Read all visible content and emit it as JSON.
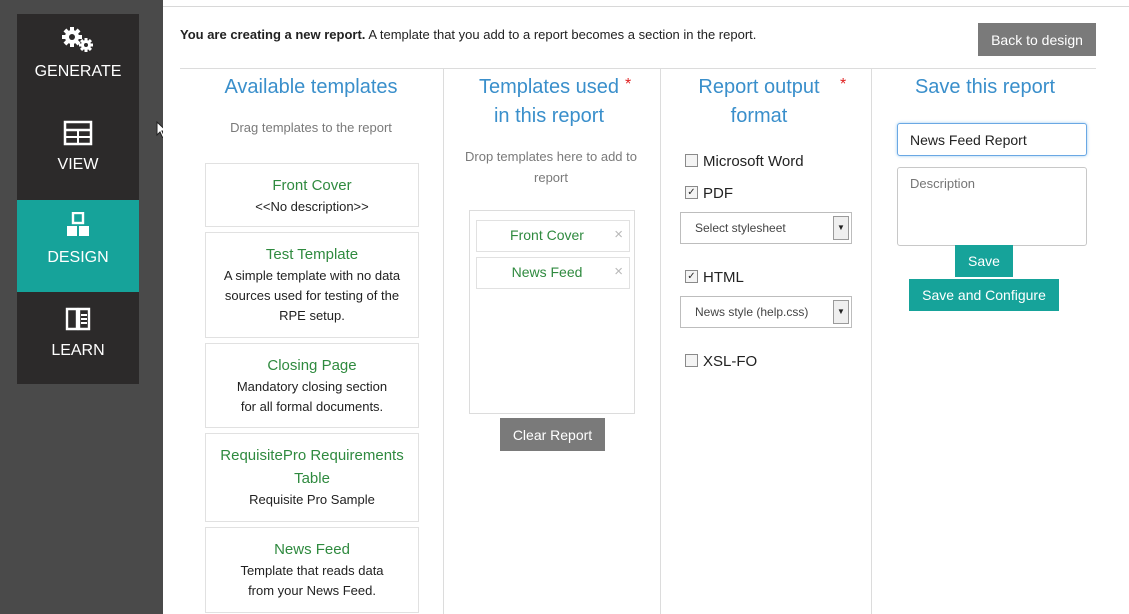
{
  "nav": {
    "items": [
      {
        "label": "GENERATE",
        "icon": "gears-icon"
      },
      {
        "label": "VIEW",
        "icon": "table-icon"
      },
      {
        "label": "DESIGN",
        "icon": "blocks-icon",
        "active": true
      },
      {
        "label": "LEARN",
        "icon": "book-icon"
      }
    ]
  },
  "header": {
    "intro_bold": "You are creating a new report.",
    "intro_rest": " A template that you add to a report becomes a section in the report.",
    "back_label": "Back to design"
  },
  "available": {
    "title": "Available templates",
    "hint": "Drag templates to the report",
    "templates": [
      {
        "name": "Front Cover",
        "desc": "<<No description>>"
      },
      {
        "name": "Test Template",
        "desc": "A simple template with no data sources used for testing of the RPE setup."
      },
      {
        "name": "Closing Page",
        "desc": "Mandatory closing section for all formal documents."
      },
      {
        "name": "RequisitePro Requirements Table",
        "desc": "Requisite Pro Sample"
      },
      {
        "name": "News Feed",
        "desc": "Template that reads data from your News Feed."
      }
    ]
  },
  "used": {
    "title_line1": "Templates used",
    "title_line2": "in this report",
    "required_mark": "*",
    "hint": "Drop templates here to add to report",
    "items": [
      {
        "label": "Front Cover",
        "remove": "×"
      },
      {
        "label": "News Feed",
        "remove": "×"
      }
    ],
    "clear_label": "Clear Report"
  },
  "output": {
    "title_line1": "Report output",
    "title_line2": "format",
    "required_mark": "*",
    "formats": [
      {
        "label": "Microsoft Word",
        "checked": false
      },
      {
        "label": "PDF",
        "checked": true
      },
      {
        "label": "HTML",
        "checked": true
      },
      {
        "label": "XSL-FO",
        "checked": false
      }
    ],
    "pdf_stylesheet": "Select stylesheet",
    "html_stylesheet": "News style (help.css)"
  },
  "save": {
    "title": "Save this report",
    "name_value": "News Feed Report",
    "desc_placeholder": "Description",
    "save_label": "Save",
    "save_configure_label": "Save and Configure"
  },
  "colors": {
    "accent": "#16a39a",
    "title_blue": "#3a8fcb",
    "template_green": "#2f8a3f",
    "required_red": "#e02020"
  }
}
